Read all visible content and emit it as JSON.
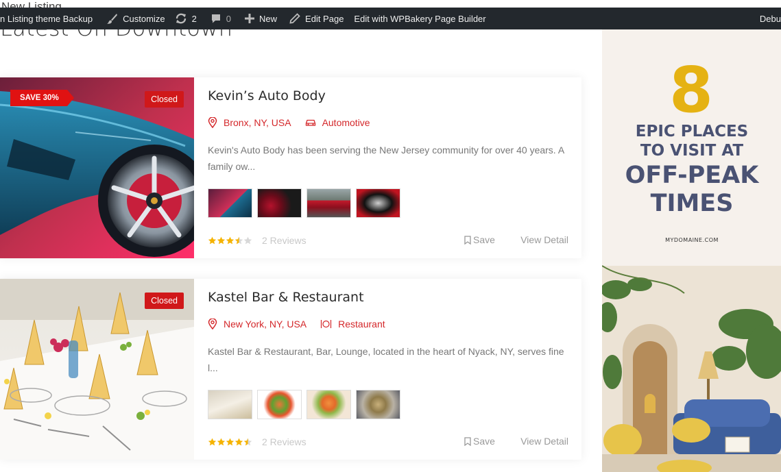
{
  "page": {
    "peek_title": "New Listing",
    "section_title": "Latest On Downtown"
  },
  "admin_bar": {
    "site_label": "n Listing theme Backup",
    "customize": "Customize",
    "updates_count": "2",
    "comments_count": "0",
    "new": "New",
    "edit_page": "Edit Page",
    "wpbakery": "Edit with WPBakery Page Builder",
    "debug": "Debu"
  },
  "listings": [
    {
      "title": "Kevin’s Auto Body",
      "save_badge": "SAVE 30%",
      "status": "Closed",
      "location": "Bronx, NY, USA",
      "category": "Automotive",
      "category_icon": "car-icon",
      "description": "Kevin's Auto Body has been serving the New Jersey community for over 40 years. A family ow...",
      "rating": 3.5,
      "reviews": "2 Reviews",
      "save_label": "Save",
      "detail_label": "View Detail"
    },
    {
      "title": "Kastel Bar & Restaurant",
      "status": "Closed",
      "location": "New York, NY, USA",
      "category": "Restaurant",
      "category_icon": "dining-icon",
      "description": "Kastel Bar & Restaurant, Bar, Lounge, located in the heart of Nyack, NY, serves fine l...",
      "rating": 4.5,
      "reviews": "2 Reviews",
      "save_label": "Save",
      "detail_label": "View Detail"
    }
  ],
  "ad": {
    "number": "8",
    "line1": "EPIC PLACES",
    "line2": "TO VISIT AT",
    "line3": "OFF-PEAK",
    "line4": "TIMES",
    "domain": "MYDOMAINE.COM"
  },
  "colors": {
    "accent": "#d4272a",
    "admin_bar": "#23282d",
    "star": "#f5b301",
    "ad_gold": "#e5b213",
    "ad_navy": "#4a5273"
  }
}
